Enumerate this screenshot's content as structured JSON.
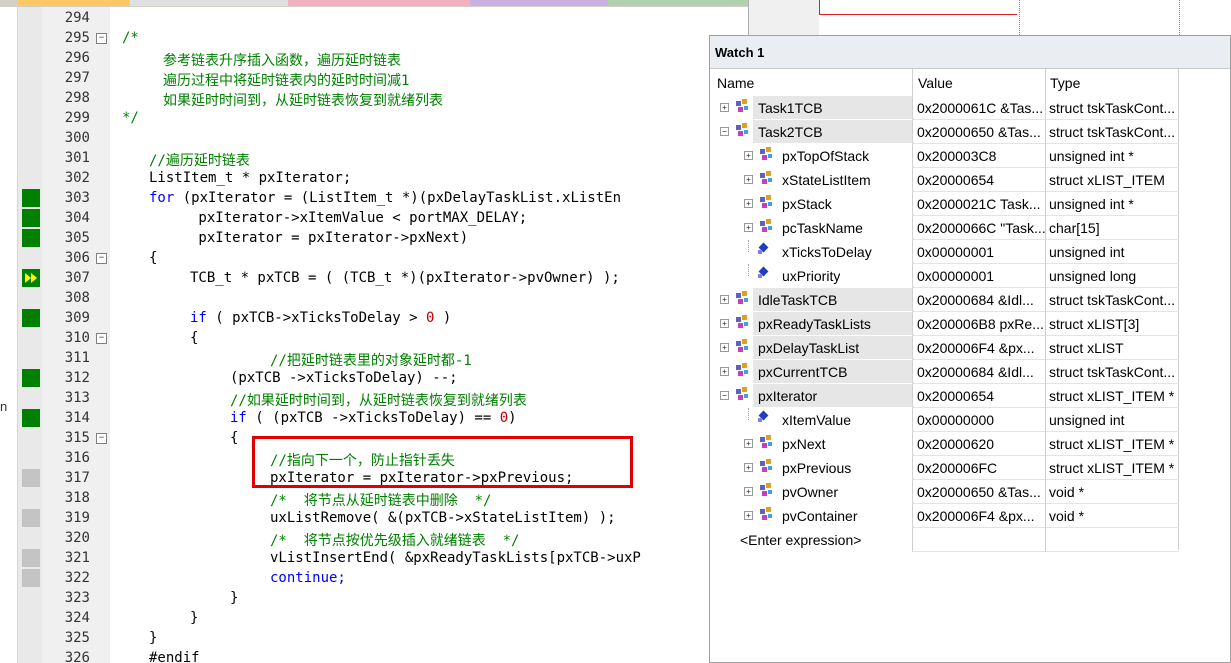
{
  "top_tabs": [
    {
      "color": "#ffc864"
    },
    {
      "color": "#e0e0e0"
    },
    {
      "color": "#f0b0c0"
    },
    {
      "color": "#c8b0e0"
    },
    {
      "color": "#b0d0b0"
    }
  ],
  "left_edge_char": "n",
  "editor": {
    "lines": [
      {
        "num": "294",
        "code": "",
        "style": "normal",
        "indent": 0,
        "mark": "none",
        "fold": ""
      },
      {
        "num": "295",
        "code": "/*",
        "style": "comment",
        "indent": 104,
        "mark": "none",
        "fold": "−"
      },
      {
        "num": "296",
        "code": "参考链表升序插入函数，遍历延时链表",
        "style": "comment",
        "indent": 145,
        "mark": "none",
        "fold": ""
      },
      {
        "num": "297",
        "code": "遍历过程中将延时链表内的延时时间减1",
        "style": "comment",
        "indent": 145,
        "mark": "none",
        "fold": ""
      },
      {
        "num": "298",
        "code": "如果延时时间到，从延时链表恢复到就绪列表",
        "style": "comment",
        "indent": 145,
        "mark": "none",
        "fold": ""
      },
      {
        "num": "299",
        "code": "*/",
        "style": "comment",
        "indent": 104,
        "mark": "none",
        "fold": ""
      },
      {
        "num": "300",
        "code": "",
        "style": "normal",
        "indent": 0,
        "mark": "none",
        "fold": ""
      },
      {
        "num": "301",
        "code": "//遍历延时链表",
        "style": "comment",
        "indent": 131,
        "mark": "none",
        "fold": ""
      },
      {
        "num": "302",
        "code": "ListItem_t * pxIterator;",
        "style": "normal",
        "indent": 131,
        "mark": "none",
        "fold": ""
      },
      {
        "num": "303",
        "code": "for (pxIterator = (ListItem_t *)(pxDelayTaskList.xListEn",
        "style": "for",
        "indent": 131,
        "mark": "green",
        "fold": ""
      },
      {
        "num": "304",
        "code": " pxIterator->xItemValue < portMAX_DELAY;",
        "style": "normal",
        "indent": 172,
        "mark": "green",
        "fold": ""
      },
      {
        "num": "305",
        "code": " pxIterator = pxIterator->pxNext)",
        "style": "normal",
        "indent": 172,
        "mark": "green",
        "fold": ""
      },
      {
        "num": "306",
        "code": "{",
        "style": "normal",
        "indent": 131,
        "mark": "none",
        "fold": "−"
      },
      {
        "num": "307",
        "code": "TCB_t * pxTCB = ( (TCB_t *)(pxIterator->pvOwner) );",
        "style": "normal",
        "indent": 172,
        "mark": "arrow",
        "fold": ""
      },
      {
        "num": "308",
        "code": "",
        "style": "normal",
        "indent": 0,
        "mark": "none",
        "fold": ""
      },
      {
        "num": "309",
        "code": "if ( pxTCB->xTicksToDelay > 0 )",
        "style": "if0",
        "indent": 172,
        "mark": "green",
        "fold": ""
      },
      {
        "num": "310",
        "code": "{",
        "style": "normal",
        "indent": 172,
        "mark": "none",
        "fold": "−"
      },
      {
        "num": "311",
        "code": "//把延时链表里的对象延时都-1",
        "style": "comment",
        "indent": 252,
        "mark": "none",
        "fold": ""
      },
      {
        "num": "312",
        "code": "(pxTCB ->xTicksToDelay) --;",
        "style": "normal",
        "indent": 212,
        "mark": "green",
        "fold": ""
      },
      {
        "num": "313",
        "code": "//如果延时时间到，从延时链表恢复到就绪列表",
        "style": "comment",
        "indent": 212,
        "mark": "none",
        "fold": ""
      },
      {
        "num": "314",
        "code": "if ( (pxTCB ->xTicksToDelay) == 0)",
        "style": "if0",
        "indent": 212,
        "mark": "green",
        "fold": ""
      },
      {
        "num": "315",
        "code": "{",
        "style": "normal",
        "indent": 212,
        "mark": "none",
        "fold": "−"
      },
      {
        "num": "316",
        "code": "//指向下一个，防止指针丢失",
        "style": "comment",
        "indent": 252,
        "mark": "none",
        "fold": ""
      },
      {
        "num": "317",
        "code": "pxIterator = pxIterator->pxPrevious;",
        "style": "normal",
        "indent": 252,
        "mark": "gray",
        "fold": ""
      },
      {
        "num": "318",
        "code": "/*  将节点从延时链表中删除  */",
        "style": "comment",
        "indent": 252,
        "mark": "none",
        "fold": ""
      },
      {
        "num": "319",
        "code": "uxListRemove( &(pxTCB->xStateListItem) );",
        "style": "normal",
        "indent": 252,
        "mark": "gray",
        "fold": ""
      },
      {
        "num": "320",
        "code": "/*  将节点按优先级插入就绪链表  */",
        "style": "comment",
        "indent": 252,
        "mark": "none",
        "fold": ""
      },
      {
        "num": "321",
        "code": "vListInsertEnd( &pxReadyTaskLists[pxTCB->uxP",
        "style": "normal",
        "indent": 252,
        "mark": "gray",
        "fold": ""
      },
      {
        "num": "322",
        "code": "continue;",
        "style": "keyword",
        "indent": 252,
        "mark": "gray",
        "fold": ""
      },
      {
        "num": "323",
        "code": "}",
        "style": "normal",
        "indent": 212,
        "mark": "none",
        "fold": ""
      },
      {
        "num": "324",
        "code": "}",
        "style": "normal",
        "indent": 172,
        "mark": "none",
        "fold": ""
      },
      {
        "num": "325",
        "code": "}",
        "style": "normal",
        "indent": 131,
        "mark": "none",
        "fold": ""
      },
      {
        "num": "326",
        "code": "#endif",
        "style": "normal",
        "indent": 131,
        "mark": "none",
        "fold": ""
      }
    ]
  },
  "watch": {
    "title": "Watch 1",
    "columns": {
      "name": "Name",
      "value": "Value",
      "type": "Type"
    },
    "rows": [
      {
        "level": 0,
        "expander": "+",
        "icon": "struct",
        "name": "Task1TCB",
        "value": "0x2000061C &Tas...",
        "type": "struct tskTaskCont..."
      },
      {
        "level": 0,
        "expander": "−",
        "icon": "struct",
        "name": "Task2TCB",
        "value": "0x20000650 &Tas...",
        "type": "struct tskTaskCont..."
      },
      {
        "level": 1,
        "expander": "+",
        "icon": "struct",
        "name": "pxTopOfStack",
        "value": "0x200003C8",
        "type": "unsigned int *"
      },
      {
        "level": 1,
        "expander": "+",
        "icon": "struct",
        "name": "xStateListItem",
        "value": "0x20000654",
        "type": "struct xLIST_ITEM"
      },
      {
        "level": 1,
        "expander": "+",
        "icon": "struct",
        "name": "pxStack",
        "value": "0x2000021C Task...",
        "type": "unsigned int *"
      },
      {
        "level": 1,
        "expander": "+",
        "icon": "struct",
        "name": "pcTaskName",
        "value": "0x2000066C \"Task...",
        "type": "char[15]"
      },
      {
        "level": 1,
        "expander": "",
        "icon": "field",
        "name": "xTicksToDelay",
        "value": "0x00000001",
        "type": "unsigned int"
      },
      {
        "level": 1,
        "expander": "",
        "icon": "field",
        "name": "uxPriority",
        "value": "0x00000001",
        "type": "unsigned long"
      },
      {
        "level": 0,
        "expander": "+",
        "icon": "struct",
        "name": "IdleTaskTCB",
        "value": "0x20000684 &Idl...",
        "type": "struct tskTaskCont..."
      },
      {
        "level": 0,
        "expander": "+",
        "icon": "struct",
        "name": "pxReadyTaskLists",
        "value": "0x200006B8 pxRe...",
        "type": "struct xLIST[3]"
      },
      {
        "level": 0,
        "expander": "+",
        "icon": "struct",
        "name": "pxDelayTaskList",
        "value": "0x200006F4 &px...",
        "type": "struct xLIST"
      },
      {
        "level": 0,
        "expander": "+",
        "icon": "struct",
        "name": "pxCurrentTCB",
        "value": "0x20000684 &Idl...",
        "type": "struct tskTaskCont..."
      },
      {
        "level": 0,
        "expander": "−",
        "icon": "struct",
        "name": "pxIterator",
        "value": "0x20000654",
        "type": "struct xLIST_ITEM *"
      },
      {
        "level": 1,
        "expander": "",
        "icon": "field",
        "name": "xItemValue",
        "value": "0x00000000",
        "type": "unsigned int"
      },
      {
        "level": 1,
        "expander": "+",
        "icon": "struct",
        "name": "pxNext",
        "value": "0x20000620",
        "type": "struct xLIST_ITEM *"
      },
      {
        "level": 1,
        "expander": "+",
        "icon": "struct",
        "name": "pxPrevious",
        "value": "0x200006FC",
        "type": "struct xLIST_ITEM *"
      },
      {
        "level": 1,
        "expander": "+",
        "icon": "struct",
        "name": "pvOwner",
        "value": "0x20000650 &Tas...",
        "type": "void *"
      },
      {
        "level": 1,
        "expander": "+",
        "icon": "struct",
        "name": "pvContainer",
        "value": "0x200006F4 &px...",
        "type": "void *"
      }
    ],
    "enter_expression": "<Enter expression>"
  }
}
